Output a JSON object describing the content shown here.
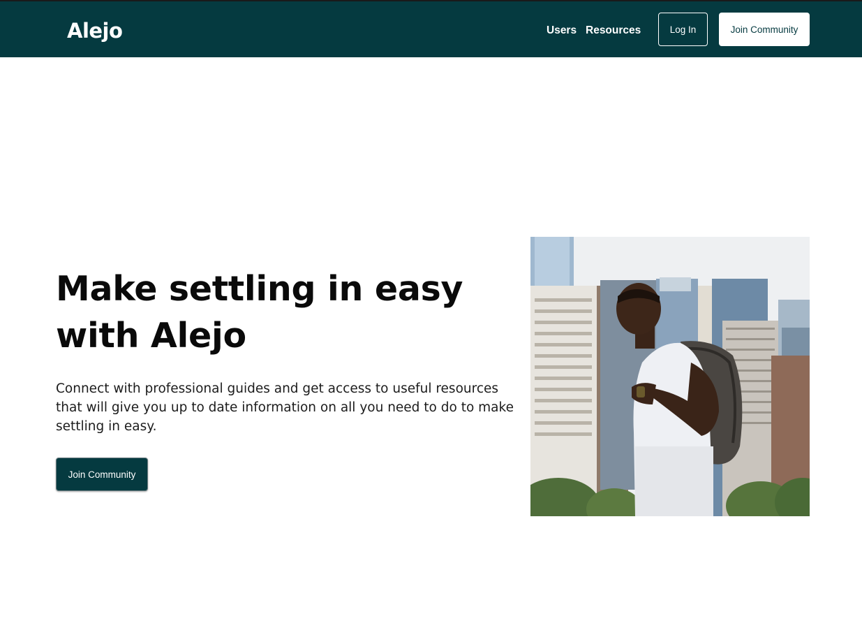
{
  "nav": {
    "logo": "Alejo",
    "links": [
      {
        "label": "Users"
      },
      {
        "label": "Resources"
      }
    ],
    "login_label": "Log In",
    "join_label": "Join Community"
  },
  "hero": {
    "title": "Make settling in easy with Alejo",
    "description": "Connect with professional guides and get access to useful resources that will give you up to date information on all you need to do to make settling in easy.",
    "cta_label": "Join Community",
    "image_alt": "Man with backpack in front of city skyline"
  },
  "colors": {
    "brand_dark_teal": "#053a40",
    "background": "#ffffff",
    "text": "#0a0a0a"
  }
}
